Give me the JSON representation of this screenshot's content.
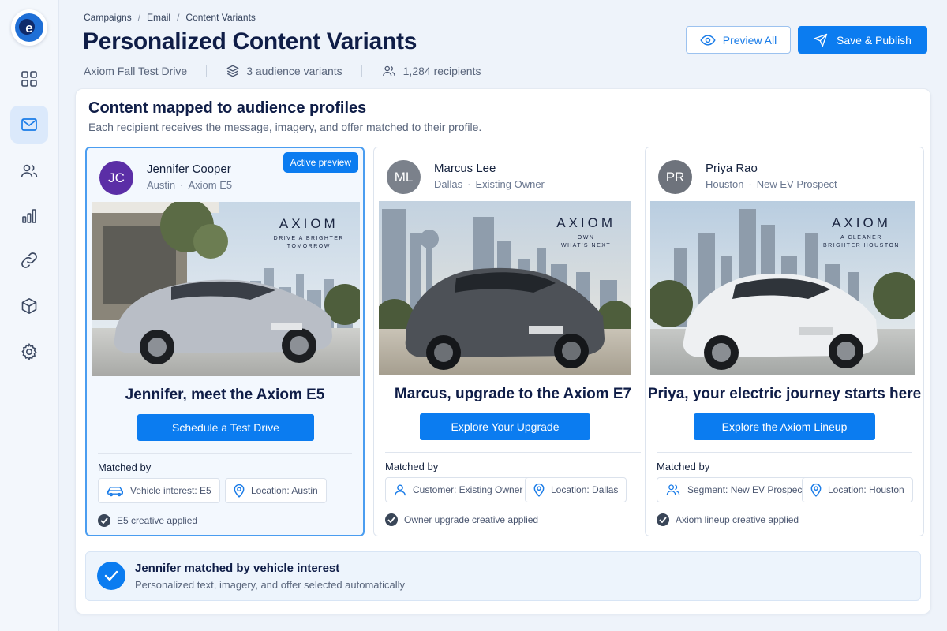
{
  "breadcrumb": [
    "Campaigns",
    "Email",
    "Content Variants"
  ],
  "page": {
    "title": "Personalized Content Variants",
    "campaign": "Axiom Fall Test Drive",
    "variants": "3 audience variants",
    "recipients": "1,284 recipients"
  },
  "actions": {
    "preview_all": "Preview All",
    "save_publish": "Save & Publish"
  },
  "panel": {
    "heading": "Content mapped to audience profiles",
    "subheading": "Each recipient receives the message, imagery, and offer matched to their profile."
  },
  "cards": [
    {
      "initials": "JC",
      "name": "Jennifer Cooper",
      "city": "Austin",
      "segment": "Axiom E5",
      "badge": "Active preview",
      "brand": "AXIOM",
      "tagline": "DRIVE A BRIGHTER\nTOMORROW",
      "headline": "Jennifer, meet the Axiom E5",
      "cta": "Schedule a Test Drive",
      "matched_label": "Matched by",
      "chip1": "Vehicle interest: E5",
      "chip2": "Location: Austin",
      "applied": "E5 creative applied",
      "avatar_color": "#5b2ea6",
      "car_color": "#b9bec6"
    },
    {
      "initials": "ML",
      "name": "Marcus Lee",
      "city": "Dallas",
      "segment": "Existing Owner",
      "brand": "AXIOM",
      "tagline": "OWN\nWHAT'S NEXT",
      "headline": "Marcus, upgrade to the Axiom E7",
      "cta": "Explore Your Upgrade",
      "matched_label": "Matched by",
      "chip1": "Customer: Existing Owner",
      "chip2": "Location: Dallas",
      "applied": "Owner upgrade creative applied",
      "avatar_color": "#7b818b",
      "car_color": "#4d5157"
    },
    {
      "initials": "PR",
      "name": "Priya Rao",
      "city": "Houston",
      "segment": "New EV Prospect",
      "brand": "AXIOM",
      "tagline": "A CLEANER\nBRIGHTER HOUSTON",
      "headline": "Priya, your electric journey starts here",
      "cta": "Explore the Axiom Lineup",
      "matched_label": "Matched by",
      "chip1": "Segment: New EV Prospect",
      "chip2": "Location: Houston",
      "applied": "Axiom lineup creative applied",
      "avatar_color": "#6e737c",
      "car_color": "#eef0f2"
    }
  ],
  "footer": {
    "title": "Jennifer matched by vehicle interest",
    "subtitle": "Personalized text, imagery, and offer selected automatically"
  },
  "icons": {
    "nav": [
      "dashboard-icon",
      "mail-icon",
      "users-icon",
      "bar-chart-icon",
      "link-icon",
      "box-icon",
      "settings-icon"
    ]
  },
  "colors": {
    "primary": "#0b7cf0",
    "title": "#0f1d47",
    "active_nav": "#dbe9fb"
  }
}
